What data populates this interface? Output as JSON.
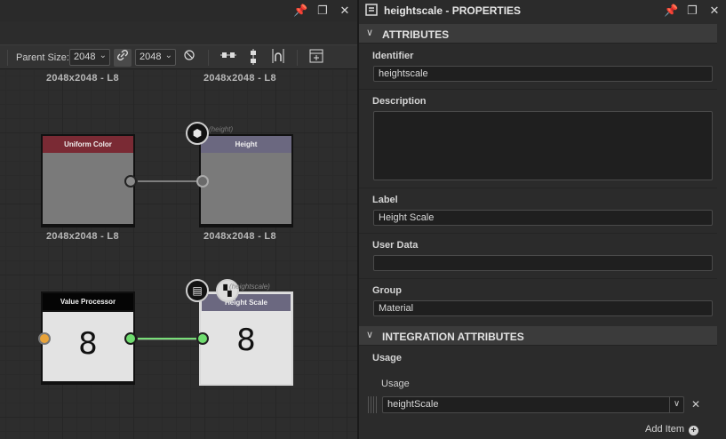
{
  "graph": {
    "toolbar": {
      "parent_size_label": "Parent Size:",
      "width_value": "2048",
      "height_value": "2048"
    },
    "nodes": {
      "top_left_resolution": "2048x2048 - L8",
      "top_right_resolution": "2048x2048 - L8",
      "uniform_color": {
        "title": "Uniform Color",
        "resolution": "2048x2048 - L8"
      },
      "height": {
        "title": "Height",
        "resolution": "2048x2048 - L8",
        "tag": "(height)"
      },
      "value_processor": {
        "title": "Value Processor",
        "value": "8"
      },
      "height_scale": {
        "title": "Height Scale",
        "value": "8",
        "tag": "(heightscale)"
      }
    }
  },
  "properties": {
    "title": "heightscale - PROPERTIES",
    "sections": {
      "attributes": "ATTRIBUTES",
      "integration": "INTEGRATION ATTRIBUTES"
    },
    "fields": {
      "identifier_label": "Identifier",
      "identifier_value": "heightscale",
      "description_label": "Description",
      "description_value": "",
      "label_label": "Label",
      "label_value": "Height Scale",
      "user_data_label": "User Data",
      "user_data_value": "",
      "group_label": "Group",
      "group_value": "Material",
      "usage_heading": "Usage",
      "usage_sub_label": "Usage",
      "usage_value": "heightScale"
    },
    "add_item_label": "Add Item"
  },
  "colors": {
    "uniform_color_header": "#7a2a34",
    "height_header": "#6b6880",
    "value_processor_header": "#050505",
    "height_scale_header": "#6b6880",
    "connection_active": "#6fdc6f",
    "port_orange": "#e8a33a"
  }
}
